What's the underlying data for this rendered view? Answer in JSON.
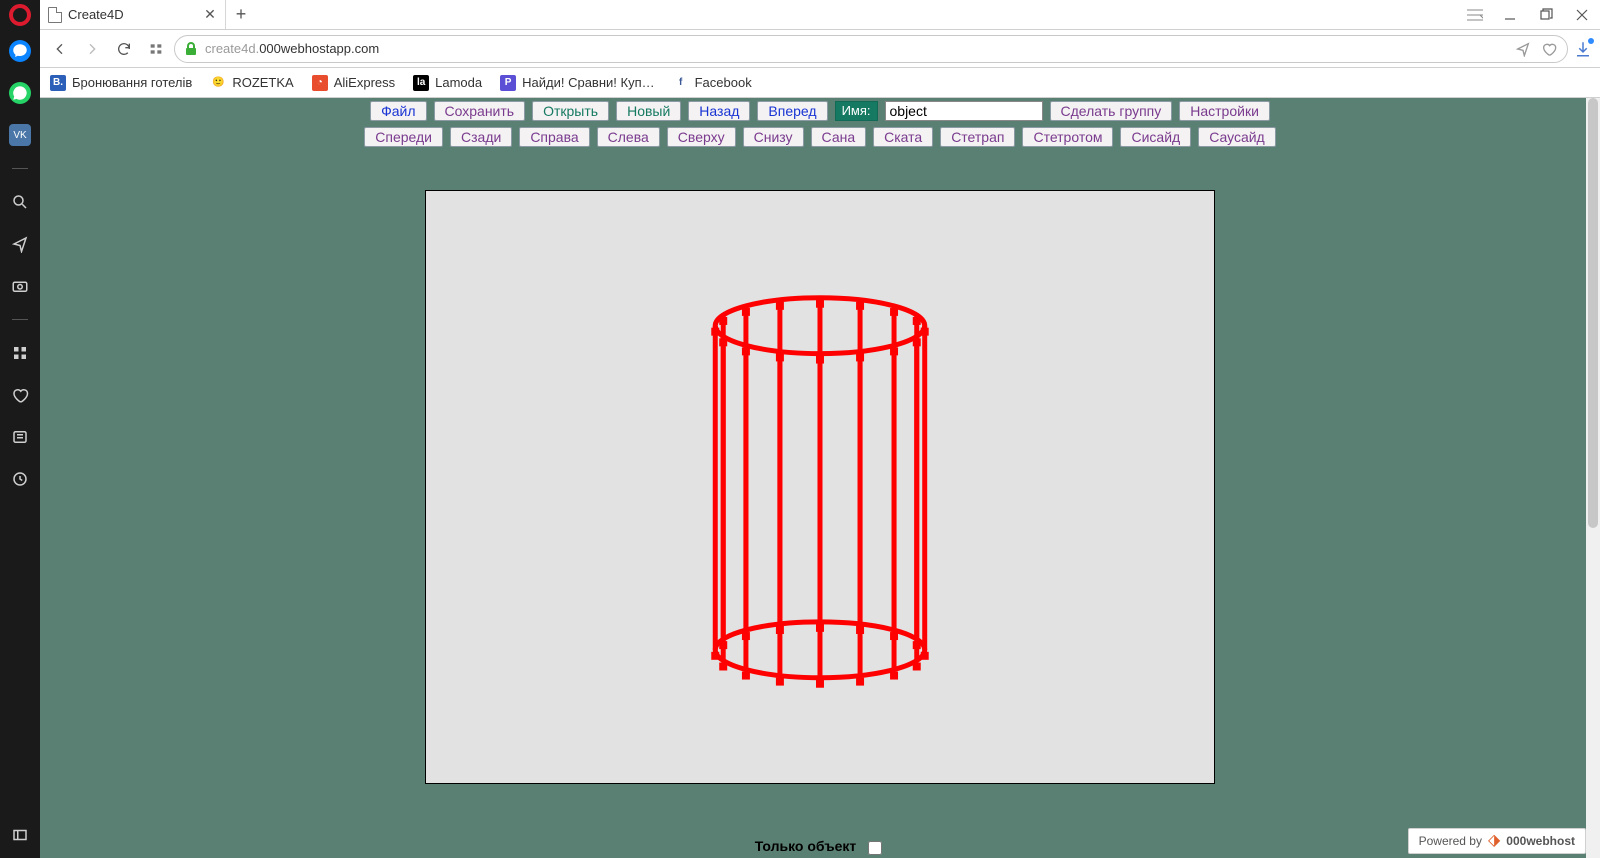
{
  "titlebar": {
    "tab_title": "Create4D"
  },
  "address": {
    "dim_prefix": "create4d.",
    "host": "000webhostapp.com"
  },
  "bookmarks": [
    {
      "label": "Бронювання готелів",
      "icon_bg": "#2b5fb8",
      "icon_fg": "#fff",
      "icon_text": "B."
    },
    {
      "label": "ROZETKA",
      "icon_bg": "#fff",
      "icon_fg": "#3aae36",
      "icon_text": "🙂"
    },
    {
      "label": "AliExpress",
      "icon_bg": "#e84d2e",
      "icon_fg": "#fff",
      "icon_text": "◔"
    },
    {
      "label": "Lamoda",
      "icon_bg": "#000",
      "icon_fg": "#fff",
      "icon_text": "la"
    },
    {
      "label": "Найди! Сравни! Куп…",
      "icon_bg": "#5b4fd6",
      "icon_fg": "#fff",
      "icon_text": "P"
    },
    {
      "label": "Facebook",
      "icon_bg": "#fff",
      "icon_fg": "#3b5998",
      "icon_text": "f"
    }
  ],
  "toolbar_row1": [
    {
      "label": "Файл",
      "cls": "blue"
    },
    {
      "label": "Сохранить",
      "cls": ""
    },
    {
      "label": "Открыть",
      "cls": "teal"
    },
    {
      "label": "Новый",
      "cls": "teal"
    },
    {
      "label": "Назад",
      "cls": "blue"
    },
    {
      "label": "Вперед",
      "cls": "blue"
    }
  ],
  "name_label": "Имя:",
  "name_value": "object",
  "toolbar_row1b": [
    {
      "label": "Сделать группу",
      "cls": ""
    },
    {
      "label": "Настройки",
      "cls": ""
    }
  ],
  "toolbar_row2": [
    {
      "label": "Спереди"
    },
    {
      "label": "Сзади"
    },
    {
      "label": "Справа"
    },
    {
      "label": "Слева"
    },
    {
      "label": "Сверху"
    },
    {
      "label": "Снизу"
    },
    {
      "label": "Сана"
    },
    {
      "label": "Ската"
    },
    {
      "label": "Стетрап"
    },
    {
      "label": "Стетротом"
    },
    {
      "label": "Сисайд"
    },
    {
      "label": "Саусайд"
    }
  ],
  "bottom_label": "Только объект",
  "powered_prefix": "Powered by",
  "powered_name": "000webhost"
}
